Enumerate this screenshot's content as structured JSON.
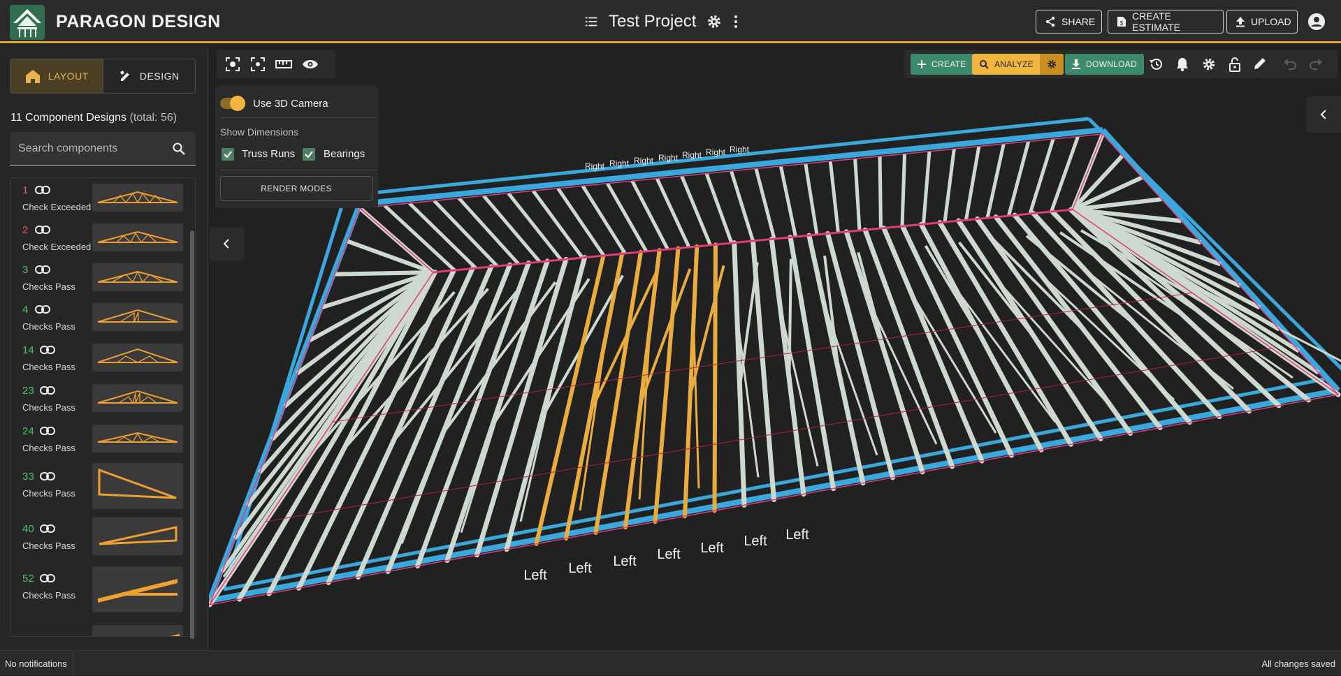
{
  "app": {
    "brand": "PARAGON DESIGN",
    "project_title": "Test Project"
  },
  "header": {
    "share": "SHARE",
    "create_estimate": "CREATE ESTIMATE",
    "upload": "UPLOAD"
  },
  "sidebar": {
    "tabs": [
      {
        "label": "LAYOUT",
        "active": true
      },
      {
        "label": "DESIGN",
        "active": false
      }
    ],
    "count_main": "11 Component Designs",
    "count_sub": "(total: 56)",
    "search_placeholder": "Search components",
    "items": [
      {
        "number": "1",
        "status": "Check Exceeded",
        "color": "#e05a5a"
      },
      {
        "number": "2",
        "status": "Check Exceeded",
        "color": "#e05a5a"
      },
      {
        "number": "3",
        "status": "Checks Pass",
        "color": "#4fc36b"
      },
      {
        "number": "4",
        "status": "Checks Pass",
        "color": "#4fc36b"
      },
      {
        "number": "14",
        "status": "Checks Pass",
        "color": "#4fc36b"
      },
      {
        "number": "23",
        "status": "Checks Pass",
        "color": "#4fc36b"
      },
      {
        "number": "24",
        "status": "Checks Pass",
        "color": "#4fc36b"
      },
      {
        "number": "33",
        "status": "Checks Pass",
        "color": "#4fc36b"
      },
      {
        "number": "40",
        "status": "Checks Pass",
        "color": "#4fc36b"
      },
      {
        "number": "52",
        "status": "Checks Pass",
        "color": "#4fc36b"
      }
    ]
  },
  "camera_panel": {
    "use_3d_camera": "Use 3D Camera",
    "use_3d_camera_on": true,
    "show_dimensions": "Show Dimensions",
    "truss_runs": "Truss Runs",
    "bearings": "Bearings",
    "render_modes": "RENDER MODES"
  },
  "action_bar": {
    "create": "CREATE",
    "analyze": "ANALYZE",
    "download": "DOWNLOAD"
  },
  "scene": {
    "right_labels": [
      "Right",
      "Right",
      "Right",
      "Right",
      "Right",
      "Right",
      "Right"
    ],
    "left_labels": [
      "Left",
      "Left",
      "Left",
      "Left",
      "Left",
      "Left",
      "Left"
    ]
  },
  "footer": {
    "notifications": "No notifications",
    "save_status": "All changes saved"
  },
  "colors": {
    "accent": "#f0b43f",
    "green": "#3c8a6c",
    "truss": "#cdd8cf",
    "bearing": "#3aa7dd",
    "run_line": "#e03c78",
    "highlight": "#e8ad3e"
  }
}
